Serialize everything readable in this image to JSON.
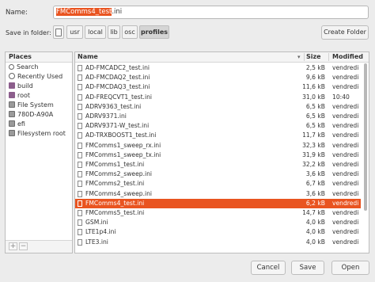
{
  "dialog": {
    "name_label": "Name:",
    "name_selected": "FMComms4_test",
    "name_rest": ".ini",
    "folder_label": "Save in folder:",
    "create_folder_label": "Create Folder"
  },
  "breadcrumb": [
    "usr",
    "local",
    "lib",
    "osc",
    "profiles"
  ],
  "places": {
    "header": "Places",
    "items": [
      {
        "label": "Search",
        "icon": "search-icon"
      },
      {
        "label": "Recently Used",
        "icon": "recent-icon"
      },
      {
        "label": "build",
        "icon": "folder-icon"
      },
      {
        "label": "root",
        "icon": "folder-icon"
      },
      {
        "label": "File System",
        "icon": "drive-icon"
      },
      {
        "label": "780D-A90A",
        "icon": "drive-icon"
      },
      {
        "label": "efi",
        "icon": "drive-icon"
      },
      {
        "label": "Filesystem root",
        "icon": "drive-icon"
      }
    ],
    "add_label": "+",
    "remove_label": "−"
  },
  "files": {
    "columns": {
      "name": "Name",
      "size": "Size",
      "modified": "Modified"
    },
    "rows": [
      {
        "name": "AD-FMCADC2_test.ini",
        "size": "2,5 kB",
        "modified": "vendredi"
      },
      {
        "name": "AD-FMCDAQ2_test.ini",
        "size": "9,6 kB",
        "modified": "vendredi"
      },
      {
        "name": "AD-FMCDAQ3_test.ini",
        "size": "11,6 kB",
        "modified": "vendredi"
      },
      {
        "name": "AD-FREQCVT1_test.ini",
        "size": "31,0 kB",
        "modified": "10:40"
      },
      {
        "name": "ADRV9363_test.ini",
        "size": "6,5 kB",
        "modified": "vendredi"
      },
      {
        "name": "ADRV9371.ini",
        "size": "6,5 kB",
        "modified": "vendredi"
      },
      {
        "name": "ADRV9371-W_test.ini",
        "size": "6,5 kB",
        "modified": "vendredi"
      },
      {
        "name": "AD-TRXBOOST1_test.ini",
        "size": "11,7 kB",
        "modified": "vendredi"
      },
      {
        "name": "FMComms1_sweep_rx.ini",
        "size": "32,3 kB",
        "modified": "vendredi"
      },
      {
        "name": "FMComms1_sweep_tx.ini",
        "size": "31,9 kB",
        "modified": "vendredi"
      },
      {
        "name": "FMComms1_test.ini",
        "size": "32,2 kB",
        "modified": "vendredi"
      },
      {
        "name": "FMComms2_sweep.ini",
        "size": "3,6 kB",
        "modified": "vendredi"
      },
      {
        "name": "FMComms2_test.ini",
        "size": "6,7 kB",
        "modified": "vendredi"
      },
      {
        "name": "FMComms4_sweep.ini",
        "size": "3,6 kB",
        "modified": "vendredi"
      },
      {
        "name": "FMComms4_test.ini",
        "size": "6,2 kB",
        "modified": "vendredi",
        "selected": true
      },
      {
        "name": "FMComms5_test.ini",
        "size": "14,7 kB",
        "modified": "vendredi"
      },
      {
        "name": "GSM.ini",
        "size": "4,0 kB",
        "modified": "vendredi"
      },
      {
        "name": "LTE1p4.ini",
        "size": "4,0 kB",
        "modified": "vendredi"
      },
      {
        "name": "LTE3.ini",
        "size": "4,0 kB",
        "modified": "vendredi"
      }
    ]
  },
  "buttons": {
    "cancel": "Cancel",
    "save": "Save",
    "open": "Open"
  },
  "colors": {
    "accent": "#e95420",
    "window_bg": "#ececec"
  }
}
